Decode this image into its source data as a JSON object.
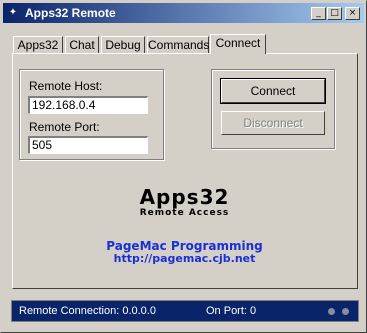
{
  "window": {
    "title": "Apps32 Remote"
  },
  "titlebar": {
    "minimize": "_",
    "maximize": "□",
    "close": "×"
  },
  "tabs": [
    {
      "label": "Apps32"
    },
    {
      "label": "Chat"
    },
    {
      "label": "Debug"
    },
    {
      "label": "Commands"
    },
    {
      "label": "Connect",
      "active": true
    }
  ],
  "form": {
    "host_label": "Remote Host:",
    "host_value": "192.168.0.4",
    "port_label": "Remote Port:",
    "port_value": "505"
  },
  "buttons": {
    "connect": "Connect",
    "disconnect": "Disconnect"
  },
  "brand": {
    "name": "Apps32",
    "tagline": "Remote Access",
    "company": "PageMac Programming",
    "url": "http://pagemac.cjb.net"
  },
  "status": {
    "connection": "Remote Connection: 0.0.0.0",
    "port": "On Port:  0"
  },
  "colors": {
    "titlebar": "#0a246a",
    "status_bg": "#0a246a",
    "link": "#1a2fd6"
  }
}
